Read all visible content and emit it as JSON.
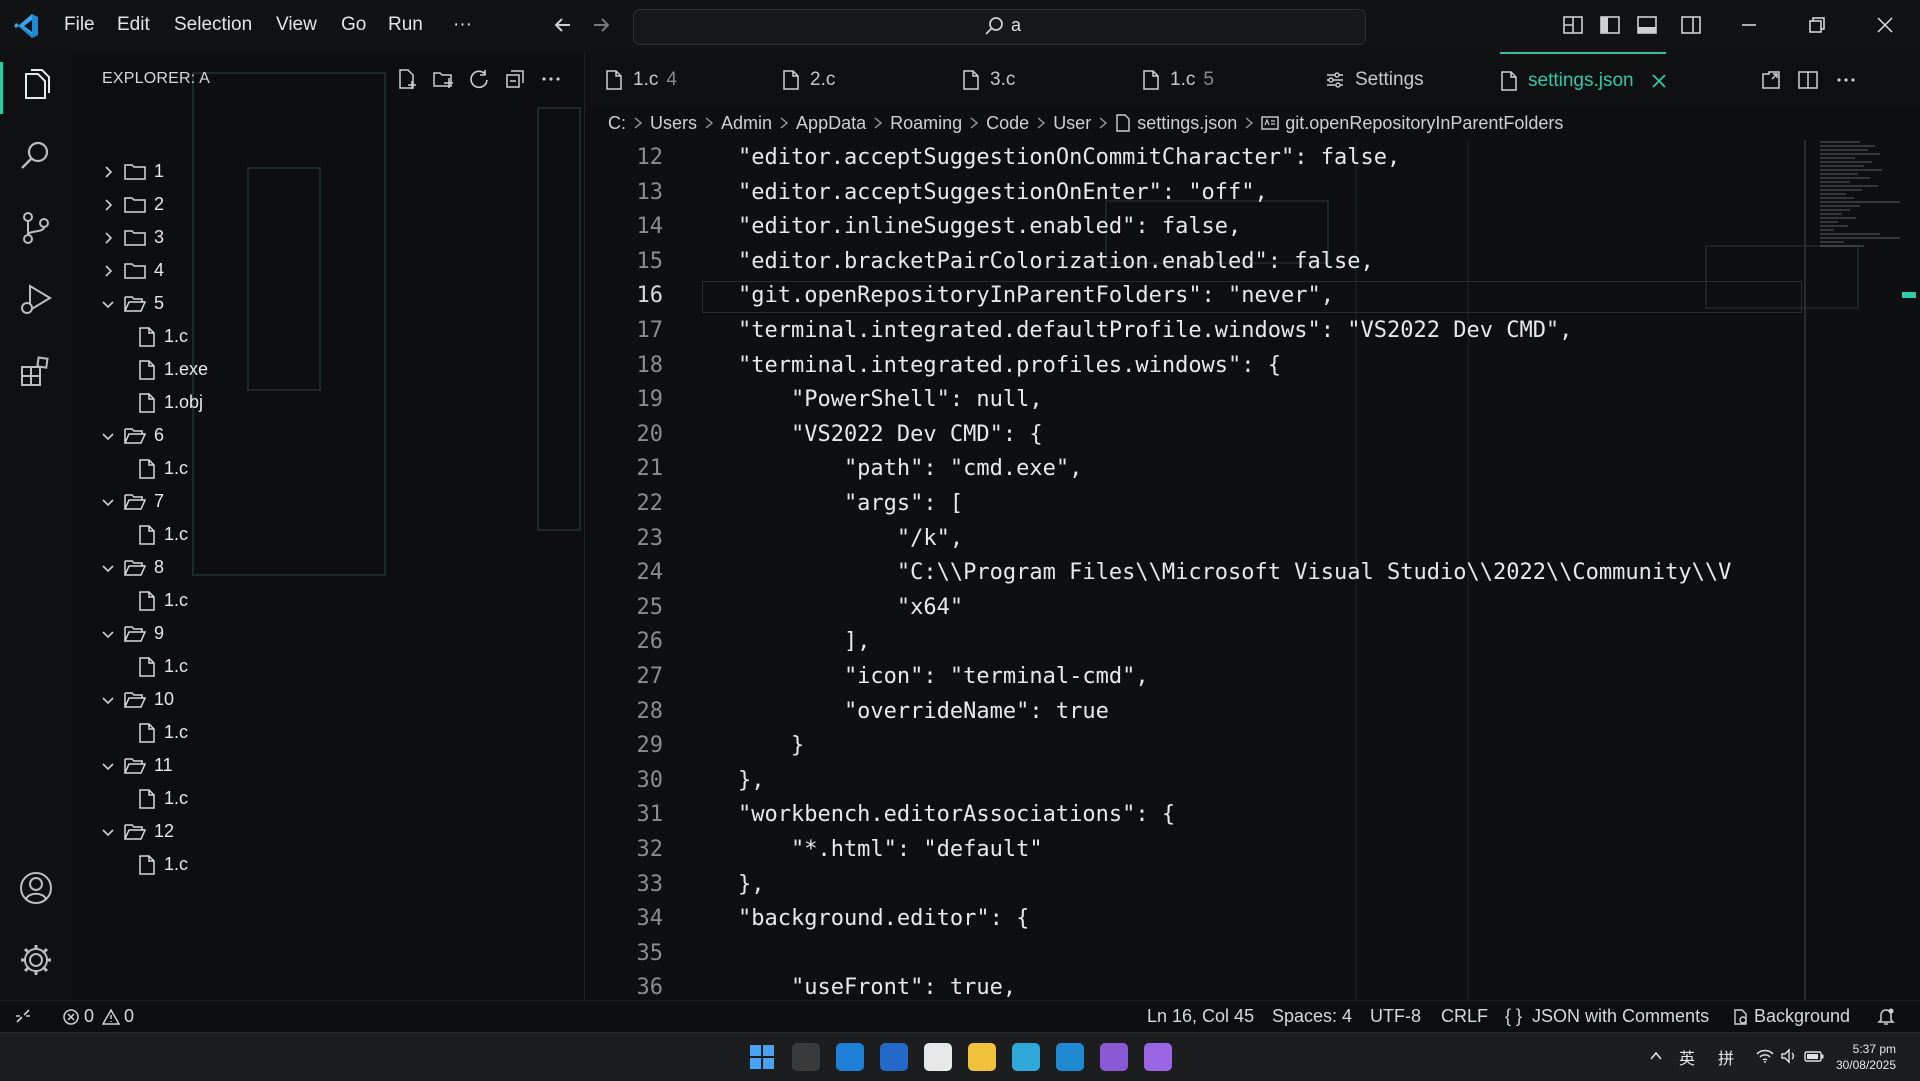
{
  "menu": [
    "File",
    "Edit",
    "Selection",
    "View",
    "Go",
    "Run",
    "···"
  ],
  "command_center": {
    "search_text": "a"
  },
  "explorer": {
    "title": "EXPLORER: A",
    "tree": [
      {
        "label": "1",
        "kind": "folder",
        "expanded": false,
        "depth": 0
      },
      {
        "label": "2",
        "kind": "folder",
        "expanded": false,
        "depth": 0
      },
      {
        "label": "3",
        "kind": "folder",
        "expanded": false,
        "depth": 0
      },
      {
        "label": "4",
        "kind": "folder",
        "expanded": false,
        "depth": 0
      },
      {
        "label": "5",
        "kind": "folder",
        "expanded": true,
        "depth": 0
      },
      {
        "label": "1.c",
        "kind": "file",
        "depth": 1
      },
      {
        "label": "1.exe",
        "kind": "file",
        "depth": 1
      },
      {
        "label": "1.obj",
        "kind": "file",
        "depth": 1
      },
      {
        "label": "6",
        "kind": "folder",
        "expanded": true,
        "depth": 0
      },
      {
        "label": "1.c",
        "kind": "file",
        "depth": 1
      },
      {
        "label": "7",
        "kind": "folder",
        "expanded": true,
        "depth": 0
      },
      {
        "label": "1.c",
        "kind": "file",
        "depth": 1
      },
      {
        "label": "8",
        "kind": "folder",
        "expanded": true,
        "depth": 0
      },
      {
        "label": "1.c",
        "kind": "file",
        "depth": 1
      },
      {
        "label": "9",
        "kind": "folder",
        "expanded": true,
        "depth": 0
      },
      {
        "label": "1.c",
        "kind": "file",
        "depth": 1
      },
      {
        "label": "10",
        "kind": "folder",
        "expanded": true,
        "depth": 0
      },
      {
        "label": "1.c",
        "kind": "file",
        "depth": 1
      },
      {
        "label": "11",
        "kind": "folder",
        "expanded": true,
        "depth": 0
      },
      {
        "label": "1.c",
        "kind": "file",
        "depth": 1
      },
      {
        "label": "12",
        "kind": "folder",
        "expanded": true,
        "depth": 0
      },
      {
        "label": "1.c",
        "kind": "file",
        "depth": 1
      }
    ]
  },
  "tabs": [
    {
      "label": "1.c",
      "badge": "4",
      "icon": "file-icon",
      "active": false
    },
    {
      "label": "2.c",
      "badge": "",
      "icon": "file-icon",
      "active": false
    },
    {
      "label": "3.c",
      "badge": "",
      "icon": "file-icon",
      "active": false
    },
    {
      "label": "1.c",
      "badge": "5",
      "icon": "file-icon",
      "active": false
    },
    {
      "label": "Settings",
      "badge": "",
      "icon": "settings-icon",
      "active": false
    },
    {
      "label": "settings.json",
      "badge": "",
      "icon": "file-icon",
      "active": true
    }
  ],
  "breadcrumb": [
    "C:",
    "Users",
    "Admin",
    "AppData",
    "Roaming",
    "Code",
    "User",
    "settings.json",
    "git.openRepositoryInParentFolders"
  ],
  "editor": {
    "current_line": 16,
    "lines": [
      {
        "n": "12",
        "t": "    \"editor.acceptSuggestionOnCommitCharacter\": false,"
      },
      {
        "n": "13",
        "t": "    \"editor.acceptSuggestionOnEnter\": \"off\","
      },
      {
        "n": "14",
        "t": "    \"editor.inlineSuggest.enabled\": false,"
      },
      {
        "n": "15",
        "t": "    \"editor.bracketPairColorization.enabled\": false,"
      },
      {
        "n": "16",
        "t": "    \"git.openRepositoryInParentFolders\": \"never\","
      },
      {
        "n": "17",
        "t": "    \"terminal.integrated.defaultProfile.windows\": \"VS2022 Dev CMD\","
      },
      {
        "n": "18",
        "t": "    \"terminal.integrated.profiles.windows\": {"
      },
      {
        "n": "19",
        "t": "        \"PowerShell\": null,"
      },
      {
        "n": "20",
        "t": "        \"VS2022 Dev CMD\": {"
      },
      {
        "n": "21",
        "t": "            \"path\": \"cmd.exe\","
      },
      {
        "n": "22",
        "t": "            \"args\": ["
      },
      {
        "n": "23",
        "t": "                \"/k\","
      },
      {
        "n": "24",
        "t": "                \"C:\\\\Program Files\\\\Microsoft Visual Studio\\\\2022\\\\Community\\\\V"
      },
      {
        "n": "25",
        "t": "                \"x64\""
      },
      {
        "n": "26",
        "t": "            ],"
      },
      {
        "n": "27",
        "t": "            \"icon\": \"terminal-cmd\","
      },
      {
        "n": "28",
        "t": "            \"overrideName\": true"
      },
      {
        "n": "29",
        "t": "        }"
      },
      {
        "n": "30",
        "t": "    },"
      },
      {
        "n": "31",
        "t": "    \"workbench.editorAssociations\": {"
      },
      {
        "n": "32",
        "t": "        \"*.html\": \"default\""
      },
      {
        "n": "33",
        "t": "    },"
      },
      {
        "n": "34",
        "t": "    \"background.editor\": {"
      },
      {
        "n": "35",
        "t": ""
      },
      {
        "n": "36",
        "t": "        \"useFront\": true,"
      }
    ]
  },
  "status": {
    "errors": "0",
    "warnings": "0",
    "position": "Ln 16, Col 45",
    "spaces": "Spaces: 4",
    "encoding": "UTF-8",
    "eol": "CRLF",
    "language": "JSON with Comments",
    "language_prefix": "{ }",
    "background": "Background"
  },
  "taskbar": {
    "ime1": "英",
    "ime2": "拼",
    "time": "5:37 pm",
    "date": "30/08/2025",
    "apps": [
      "start",
      "terminal",
      "outlook",
      "mail",
      "notion",
      "file-explorer",
      "edge",
      "vscode",
      "visual-studio",
      "visual-studio-2"
    ]
  },
  "colors": {
    "accent": "#2fc8a8",
    "string": "#e8e8e8",
    "active_tab": "#2fc8a8"
  }
}
